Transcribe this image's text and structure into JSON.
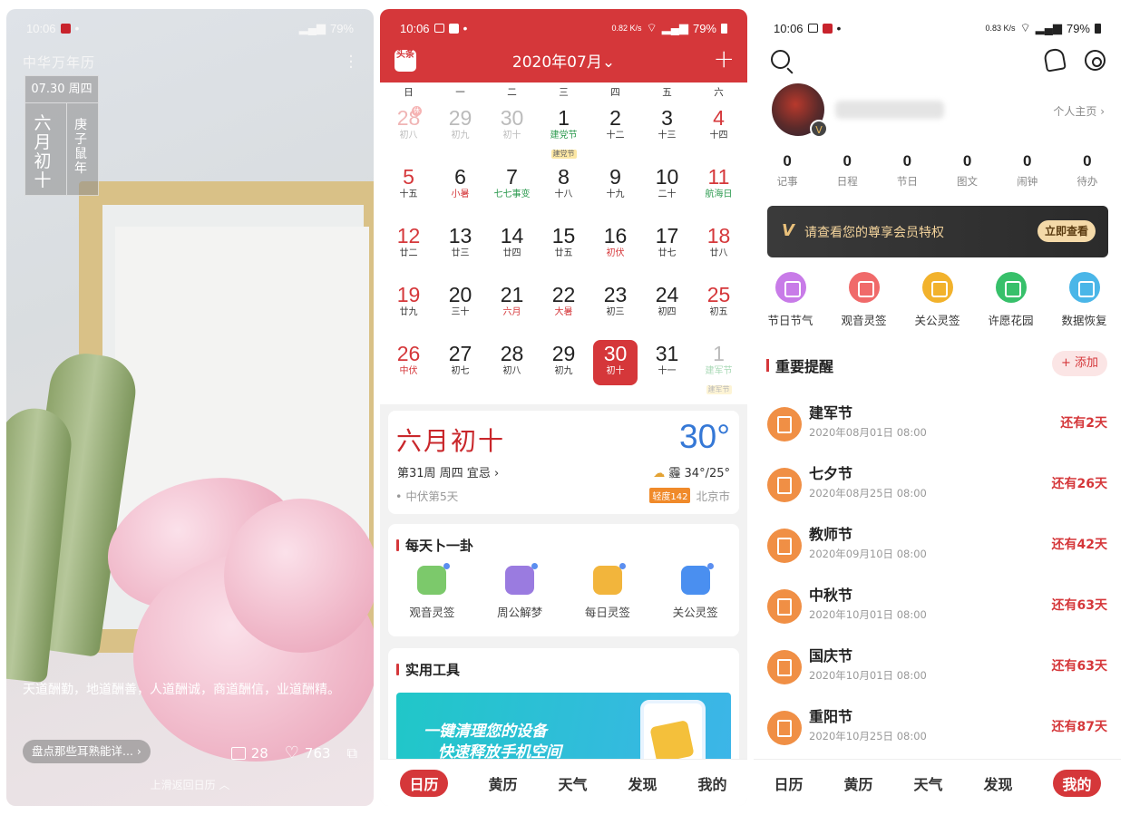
{
  "panel1": {
    "status": {
      "time": "10:06",
      "battery": "79%"
    },
    "app_title": "中华万年历",
    "date_header": "07.30 周四",
    "lunar_date": "六月初十",
    "lunar_year": "庚子鼠年",
    "quote": "天道酬勤，地道酬善，人道酬诚，商道酬信，业道酬精。",
    "article_pill": "盘点那些耳熟能详... ›",
    "comments": "28",
    "likes": "763",
    "swipe_hint": "上滑返回日历 ︿"
  },
  "panel2": {
    "status": {
      "time": "10:06",
      "speed": "0.82 K/s",
      "battery": "79%"
    },
    "logo": "头条",
    "month_title": "2020年07月⌄",
    "weekdays": [
      "日",
      "一",
      "二",
      "三",
      "四",
      "五",
      "六"
    ],
    "days": [
      {
        "n": "28",
        "s": "初八",
        "style": "grey-red",
        "badge": "休"
      },
      {
        "n": "29",
        "s": "初九",
        "style": "grey"
      },
      {
        "n": "30",
        "s": "初十",
        "style": "grey"
      },
      {
        "n": "1",
        "s": "建党节",
        "style": "",
        "sub": "gr",
        "tag": "建党节"
      },
      {
        "n": "2",
        "s": "十二",
        "style": ""
      },
      {
        "n": "3",
        "s": "十三",
        "style": ""
      },
      {
        "n": "4",
        "s": "十四",
        "style": "red"
      },
      {
        "n": "5",
        "s": "十五",
        "style": "red"
      },
      {
        "n": "6",
        "s": "小暑",
        "style": "",
        "sub": "rd"
      },
      {
        "n": "7",
        "s": "七七事变",
        "style": "",
        "sub": "gr"
      },
      {
        "n": "8",
        "s": "十八",
        "style": ""
      },
      {
        "n": "9",
        "s": "十九",
        "style": ""
      },
      {
        "n": "10",
        "s": "二十",
        "style": ""
      },
      {
        "n": "11",
        "s": "航海日",
        "style": "red",
        "sub": "gr"
      },
      {
        "n": "12",
        "s": "廿二",
        "style": "red"
      },
      {
        "n": "13",
        "s": "廿三",
        "style": ""
      },
      {
        "n": "14",
        "s": "廿四",
        "style": ""
      },
      {
        "n": "15",
        "s": "廿五",
        "style": ""
      },
      {
        "n": "16",
        "s": "初伏",
        "style": "",
        "sub": "rd"
      },
      {
        "n": "17",
        "s": "廿七",
        "style": ""
      },
      {
        "n": "18",
        "s": "廿八",
        "style": "red"
      },
      {
        "n": "19",
        "s": "廿九",
        "style": "red"
      },
      {
        "n": "20",
        "s": "三十",
        "style": ""
      },
      {
        "n": "21",
        "s": "六月",
        "style": "",
        "sub": "rd"
      },
      {
        "n": "22",
        "s": "大暑",
        "style": "",
        "sub": "rd"
      },
      {
        "n": "23",
        "s": "初三",
        "style": ""
      },
      {
        "n": "24",
        "s": "初四",
        "style": ""
      },
      {
        "n": "25",
        "s": "初五",
        "style": "red"
      },
      {
        "n": "26",
        "s": "中伏",
        "style": "red",
        "sub": "rd"
      },
      {
        "n": "27",
        "s": "初七",
        "style": ""
      },
      {
        "n": "28",
        "s": "初八",
        "style": ""
      },
      {
        "n": "29",
        "s": "初九",
        "style": ""
      },
      {
        "n": "30",
        "s": "初十",
        "style": "sel"
      },
      {
        "n": "31",
        "s": "十一",
        "style": ""
      },
      {
        "n": "1",
        "s": "建军节",
        "style": "grey",
        "tag": "建军节"
      }
    ],
    "today_card": {
      "lunar": "六月初十",
      "temperature": "30°",
      "week_line": "第31周 周四 宜忌 ›",
      "weather": "霾 34°/25°",
      "period": "中伏第5天",
      "aqi": "轻度142",
      "city": "北京市"
    },
    "divination": {
      "title": "每天卜一卦",
      "items": [
        {
          "label": "观音灵签",
          "color": "#7cc96b"
        },
        {
          "label": "周公解梦",
          "color": "#9a7be0"
        },
        {
          "label": "每日灵签",
          "color": "#f2b53c"
        },
        {
          "label": "关公灵签",
          "color": "#4a8ff0"
        }
      ]
    },
    "tools": {
      "title": "实用工具",
      "banner_line1": "一键清理您的设备",
      "banner_line2": "快速释放手机空间"
    },
    "tabs": [
      "日历",
      "黄历",
      "天气",
      "发现",
      "我的"
    ],
    "active_tab": 0
  },
  "panel3": {
    "status": {
      "time": "10:06",
      "speed": "0.83 K/s",
      "battery": "79%"
    },
    "home_link": "个人主页 ›",
    "counts": [
      {
        "v": "0",
        "k": "记事"
      },
      {
        "v": "0",
        "k": "日程"
      },
      {
        "v": "0",
        "k": "节日"
      },
      {
        "v": "0",
        "k": "图文"
      },
      {
        "v": "0",
        "k": "闹钟"
      },
      {
        "v": "0",
        "k": "待办"
      }
    ],
    "vip_text": "请查看您的尊享会员特权",
    "vip_button": "立即查看",
    "features": [
      {
        "label": "节日节气",
        "color": "#c87be8"
      },
      {
        "label": "观音灵签",
        "color": "#f06a6a"
      },
      {
        "label": "关公灵签",
        "color": "#f2b22c"
      },
      {
        "label": "许愿花园",
        "color": "#37c06a"
      },
      {
        "label": "数据恢复",
        "color": "#4ab6e8"
      }
    ],
    "reminders_title": "重要提醒",
    "add_button": "+ 添加",
    "reminders": [
      {
        "name": "建军节",
        "date": "2020年08月01日 08:00",
        "left": "还有2天"
      },
      {
        "name": "七夕节",
        "date": "2020年08月25日 08:00",
        "left": "还有26天"
      },
      {
        "name": "教师节",
        "date": "2020年09月10日 08:00",
        "left": "还有42天"
      },
      {
        "name": "中秋节",
        "date": "2020年10月01日 08:00",
        "left": "还有63天"
      },
      {
        "name": "国庆节",
        "date": "2020年10月01日 08:00",
        "left": "还有63天"
      },
      {
        "name": "重阳节",
        "date": "2020年10月25日 08:00",
        "left": "还有87天"
      }
    ],
    "tabs": [
      "日历",
      "黄历",
      "天气",
      "发现",
      "我的"
    ],
    "active_tab": 4
  }
}
